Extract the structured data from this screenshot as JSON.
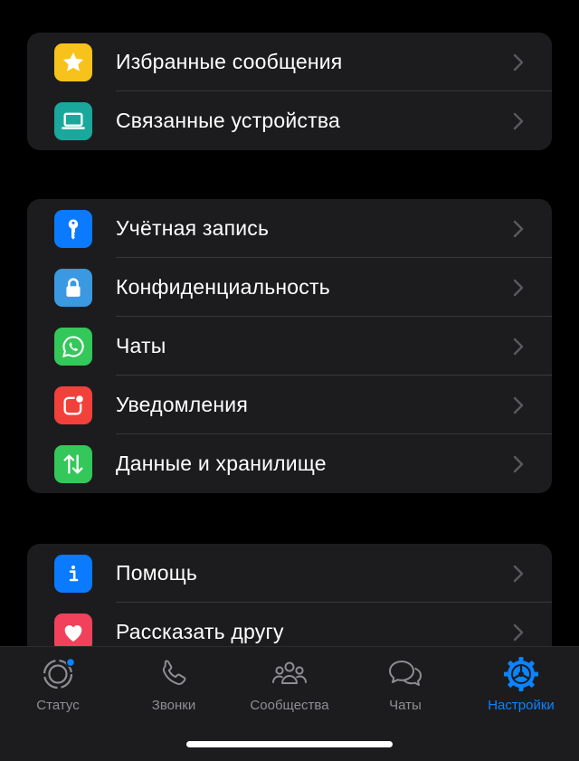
{
  "groups": [
    {
      "items": [
        {
          "label": "Избранные сообщения",
          "icon": "star-icon",
          "color": "#f7c21b"
        },
        {
          "label": "Связанные устройства",
          "icon": "laptop-icon",
          "color": "#1aa89c"
        }
      ]
    },
    {
      "items": [
        {
          "label": "Учётная запись",
          "icon": "key-icon",
          "color": "#0a7aff"
        },
        {
          "label": "Конфиденциальность",
          "icon": "lock-icon",
          "color": "#3a99e0"
        },
        {
          "label": "Чаты",
          "icon": "whatsapp-icon",
          "color": "#34c759"
        },
        {
          "label": "Уведомления",
          "icon": "notification-icon",
          "color": "#f2413a"
        },
        {
          "label": "Данные и хранилище",
          "icon": "data-transfer-icon",
          "color": "#34c759"
        }
      ]
    },
    {
      "items": [
        {
          "label": "Помощь",
          "icon": "info-icon",
          "color": "#0a7aff"
        },
        {
          "label": "Рассказать другу",
          "icon": "heart-icon",
          "color": "#f2415b"
        }
      ]
    }
  ],
  "tabbar": {
    "tabs": [
      {
        "label": "Статус",
        "icon": "status-icon",
        "active": false
      },
      {
        "label": "Звонки",
        "icon": "phone-icon",
        "active": false
      },
      {
        "label": "Сообщества",
        "icon": "communities-icon",
        "active": false
      },
      {
        "label": "Чаты",
        "icon": "chats-icon",
        "active": false
      },
      {
        "label": "Настройки",
        "icon": "settings-gear-icon",
        "active": true
      }
    ],
    "active_color": "#0a84ff",
    "inactive_color": "#8e8e93"
  }
}
